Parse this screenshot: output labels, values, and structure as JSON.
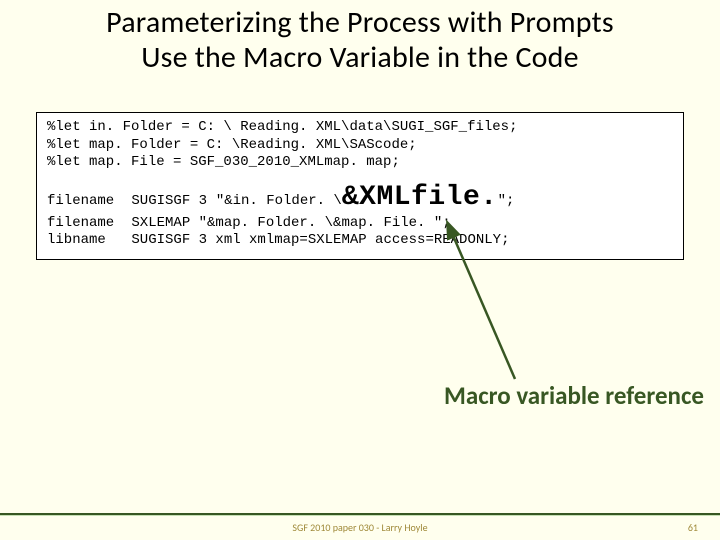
{
  "title_line1": "Parameterizing the Process with Prompts",
  "title_line2": "Use the Macro Variable in the Code",
  "code": {
    "let1": "%let in. Folder = C: \\ Reading. XML\\data\\SUGI_SGF_files;",
    "let2": "%let map. Folder = C: \\Reading. XML\\SAScode;",
    "let3": "%let map. File = SGF_030_2010_XMLmap. map;",
    "fn1_kw": "filename",
    "fn1_name": "SUGISGF 3",
    "fn1_pre": "\"&in. Folder. \\",
    "fn1_macro": "&XMLfile.",
    "fn1_post": "\";",
    "fn2_kw": "filename",
    "fn2_rest": "SXLEMAP \"&map. Folder. \\&map. File. \";",
    "lib_kw": "libname",
    "lib_rest": "SUGISGF 3 xml xmlmap=SXLEMAP access=READONLY;"
  },
  "callout": "Macro variable reference",
  "footer_center": "SGF 2010 paper 030 - Larry Hoyle",
  "footer_page": "61"
}
